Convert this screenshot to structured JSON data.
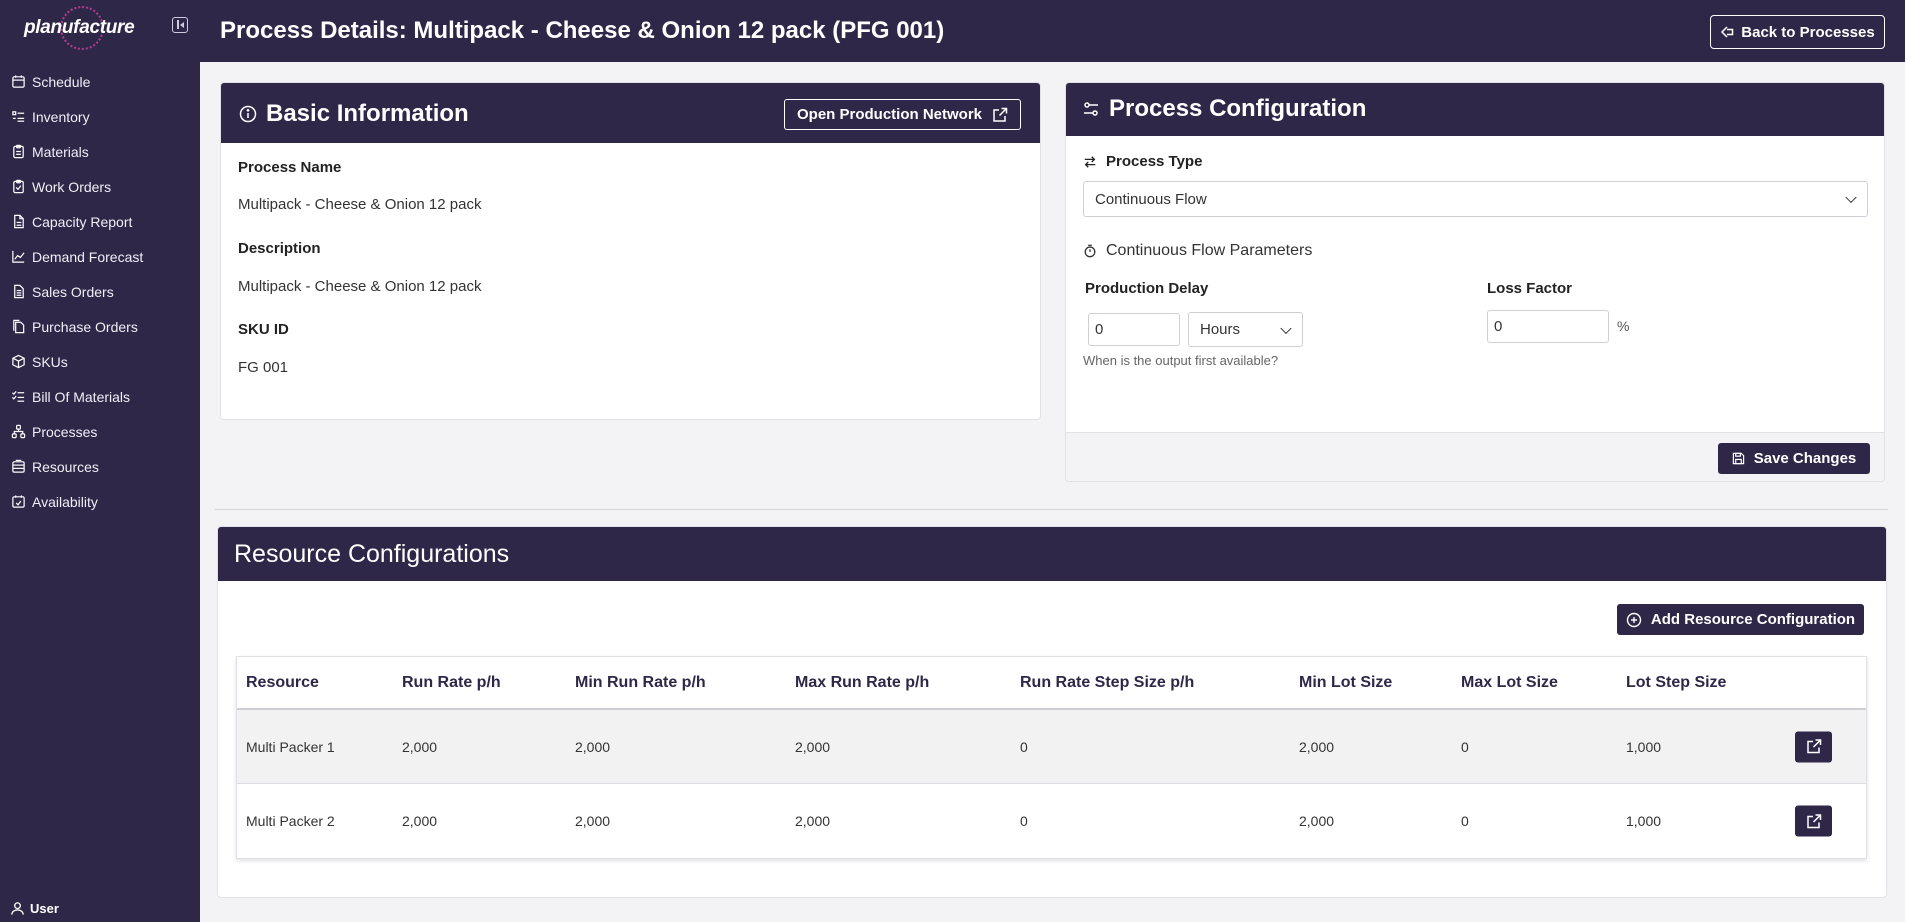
{
  "app": {
    "logo": "planufacture",
    "user": "User"
  },
  "sidebar": {
    "items": [
      {
        "label": "Schedule",
        "icon": "calendar-icon"
      },
      {
        "label": "Inventory",
        "icon": "list-icon"
      },
      {
        "label": "Materials",
        "icon": "clipboard-icon"
      },
      {
        "label": "Work Orders",
        "icon": "clipboard-check-icon"
      },
      {
        "label": "Capacity Report",
        "icon": "file-icon"
      },
      {
        "label": "Demand Forecast",
        "icon": "chart-line-icon"
      },
      {
        "label": "Sales Orders",
        "icon": "document-icon"
      },
      {
        "label": "Purchase Orders",
        "icon": "copy-icon"
      },
      {
        "label": "SKUs",
        "icon": "box-icon"
      },
      {
        "label": "Bill Of Materials",
        "icon": "checklist-icon"
      },
      {
        "label": "Processes",
        "icon": "network-icon"
      },
      {
        "label": "Resources",
        "icon": "stack-icon"
      },
      {
        "label": "Availability",
        "icon": "calendar-check-icon"
      }
    ]
  },
  "header": {
    "title": "Process Details: Multipack - Cheese & Onion 12 pack (PFG 001)",
    "back_label": "Back to Processes"
  },
  "basic": {
    "title": "Basic Information",
    "open_network_label": "Open Production Network",
    "process_name_label": "Process Name",
    "process_name": "Multipack - Cheese & Onion 12 pack",
    "description_label": "Description",
    "description": "Multipack - Cheese & Onion 12 pack",
    "sku_label": "SKU ID",
    "sku": "FG 001"
  },
  "config": {
    "title": "Process Configuration",
    "process_type_label": "Process Type",
    "process_type": "Continuous Flow",
    "params_title": "Continuous Flow Parameters",
    "delay_label": "Production Delay",
    "delay_value": "0",
    "delay_unit": "Hours",
    "delay_hint": "When is the output first available?",
    "loss_label": "Loss Factor",
    "loss_value": "0",
    "loss_unit": "%",
    "save_label": "Save Changes"
  },
  "resources": {
    "title": "Resource Configurations",
    "add_label": "Add Resource Configuration",
    "columns": [
      "Resource",
      "Run Rate p/h",
      "Min Run Rate p/h",
      "Max Run Rate p/h",
      "Run Rate Step Size p/h",
      "Min Lot Size",
      "Max Lot Size",
      "Lot Step Size"
    ],
    "rows": [
      [
        "Multi Packer 1",
        "2,000",
        "2,000",
        "2,000",
        "0",
        "2,000",
        "0",
        "1,000"
      ],
      [
        "Multi Packer 2",
        "2,000",
        "2,000",
        "2,000",
        "0",
        "2,000",
        "0",
        "1,000"
      ]
    ]
  },
  "colors": {
    "primary": "#2f2748",
    "accent": "#b23c8e"
  }
}
